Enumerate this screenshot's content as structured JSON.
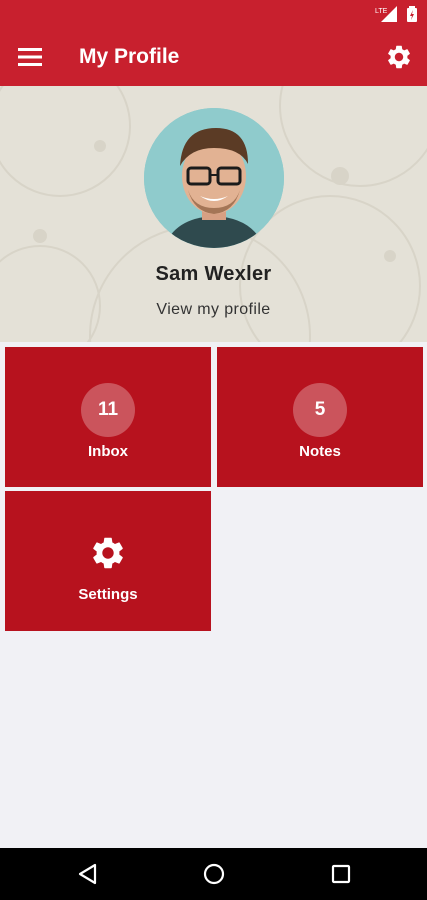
{
  "app": {
    "title": "My Profile"
  },
  "profile": {
    "name": "Sam Wexler",
    "link": "View my profile"
  },
  "tiles": [
    {
      "label": "Inbox",
      "count": "11"
    },
    {
      "label": "Notes",
      "count": "5"
    },
    {
      "label": "Settings",
      "icon": "gear-icon"
    }
  ],
  "status": {
    "network": "LTE"
  },
  "colors": {
    "primary": "#c8202e",
    "tile": "#b7121e",
    "hero_bg": "#e4e1d7",
    "page_bg": "#f1f1f5"
  }
}
